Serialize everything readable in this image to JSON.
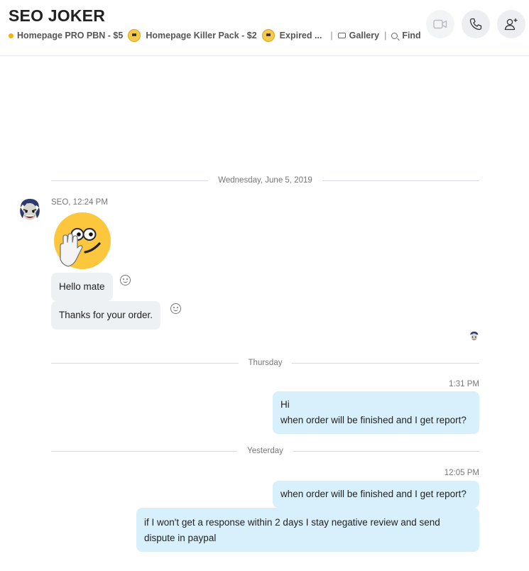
{
  "header": {
    "title": "SEO JOKER",
    "items": [
      "Homepage PRO PBN - $5",
      "Homepage  Killer Pack - $2",
      "Expired ..."
    ],
    "gallery_label": "Gallery",
    "find_label": "Find",
    "separator": "|"
  },
  "dividers": {
    "first": "Wednesday, June 5, 2019",
    "second": "Thursday",
    "third": "Yesterday"
  },
  "incoming": {
    "sender_line": "SEO, 12:24 PM",
    "messages": [
      "Hello mate",
      "Thanks for your order."
    ]
  },
  "outgoing_1": {
    "time": "1:31 PM",
    "line1": "Hi",
    "line2": "when order will be finished and I get report?"
  },
  "outgoing_2": {
    "time": "12:05 PM",
    "msg1": "when order will be finished and I get report?",
    "msg2_line1": "if I won't get a response within 2 days I stay negative review and send",
    "msg2_line2": "dispute in paypal"
  },
  "colors": {
    "accent_dot": "#f5b400",
    "incoming_bubble": "#eef1f4",
    "outgoing_bubble": "#d8f0fb"
  },
  "icons": [
    "video-call-icon",
    "phone-call-icon",
    "add-person-icon",
    "gallery-icon",
    "search-icon",
    "smiley-react-icon",
    "wave-emoticon"
  ]
}
